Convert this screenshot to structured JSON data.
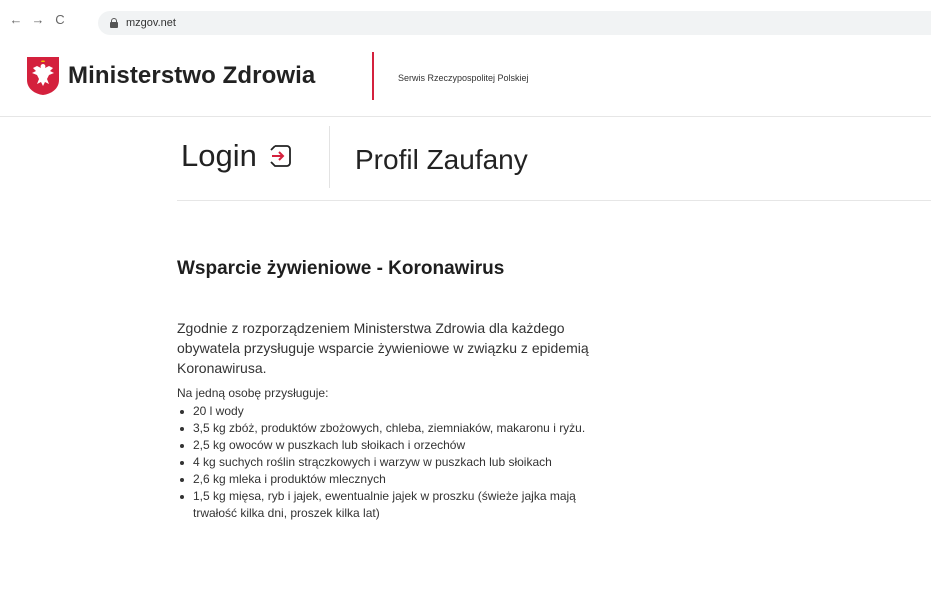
{
  "browser": {
    "back_icon": "←",
    "forward_icon": "→",
    "reload_icon": "C",
    "url": "mzgov.net"
  },
  "header": {
    "title": "Ministerstwo Zdrowia",
    "subtitle": "Serwis Rzeczypospolitej Polskiej",
    "accent_color": "#d4213d"
  },
  "login": {
    "label": "Login",
    "profile_label": "Profil Zaufany"
  },
  "content": {
    "heading": "Wsparcie żywieniowe - Koronawirus",
    "intro": "Zgodnie z rozporządzeniem Ministerstwa Zdrowia dla każdego obywatela przysługuje wsparcie żywieniowe w związku z epidemią Koronawirusa.",
    "list_lead": "Na jedną osobę przysługuje:",
    "items": [
      "20 l wody",
      "3,5 kg zbóż, produktów zbożowych, chleba, ziemniaków, makaronu i ryżu.",
      "2,5 kg owoców w puszkach lub słoikach i orzechów",
      "4 kg suchych roślin strączkowych i warzyw w puszkach lub słoikach",
      "2,6 kg mleka i produktów mlecznych",
      "1,5 kg mięsa, ryb i jajek, ewentualnie jajek w proszku (świeże jajka mają trwałość kilka dni, proszek kilka lat)"
    ]
  }
}
